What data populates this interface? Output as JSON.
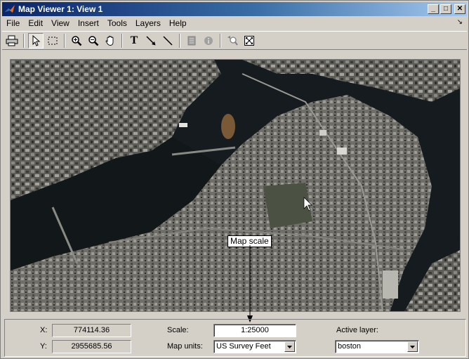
{
  "window": {
    "title": "Map Viewer 1: View 1",
    "controls": {
      "minimize": "_",
      "maximize": "□",
      "close": "✕"
    }
  },
  "menu": {
    "items": [
      "File",
      "Edit",
      "View",
      "Insert",
      "Tools",
      "Layers",
      "Help"
    ],
    "dock_glyph": "↘"
  },
  "toolbar": {
    "text_tool_label": "T",
    "tools": [
      "print-icon",
      "select-arrow-icon",
      "select-region-icon",
      "zoom-in-icon",
      "zoom-out-icon",
      "pan-hand-icon",
      "text-icon",
      "arrow-annotation-icon",
      "line-annotation-icon",
      "datatip-icon",
      "info-icon",
      "zoom-prev-icon",
      "fit-to-window-icon"
    ]
  },
  "map": {
    "annotation_label": "Map scale"
  },
  "status": {
    "x_label": "X:",
    "x_value": "774114.36",
    "y_label": "Y:",
    "y_value": "2955685.56",
    "scale_label": "Scale:",
    "scale_value": "1:25000",
    "units_label": "Map units:",
    "units_value": "US Survey Feet",
    "active_layer_label": "Active layer:",
    "active_layer_value": "boston"
  },
  "colors": {
    "title_bar": "#0a246a",
    "water": "#161b1f",
    "land": "#6d6c66",
    "window_bg": "#d4d0c8"
  }
}
